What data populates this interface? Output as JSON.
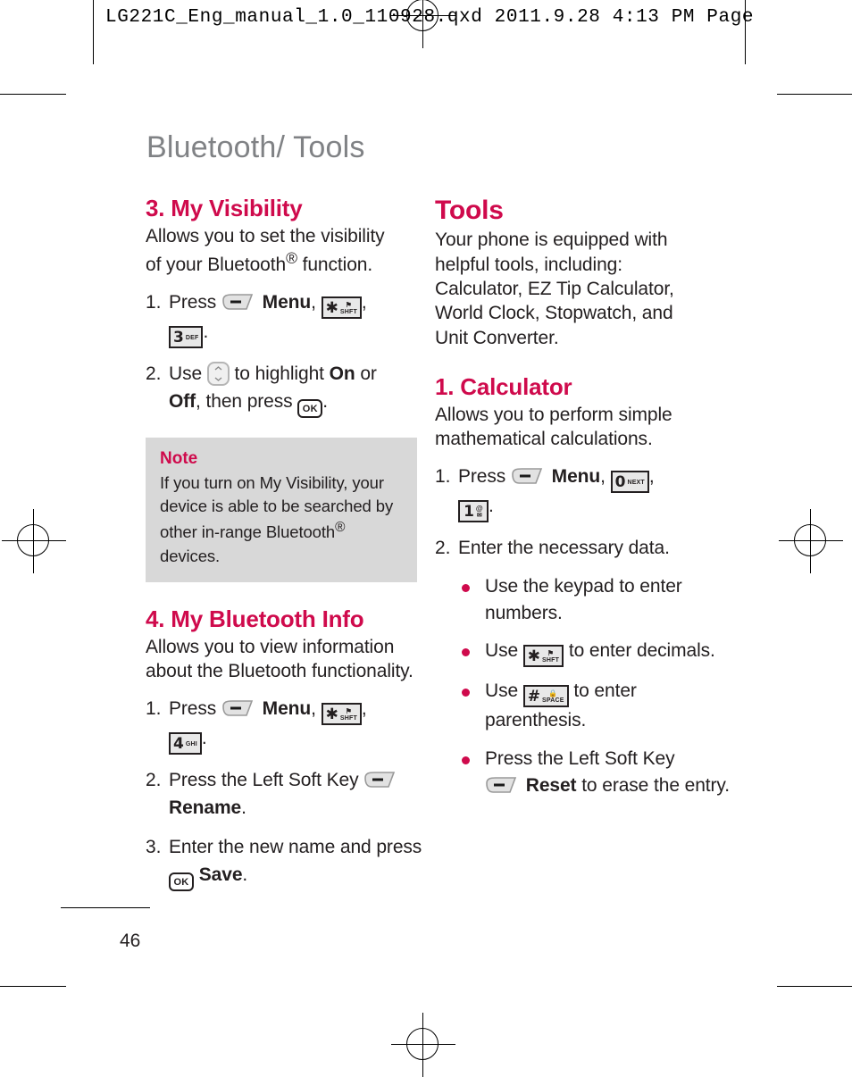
{
  "preflight": {
    "text": "LG221C_Eng_manual_1.0_110928.qxd   2011.9.28   4:13 PM   Page"
  },
  "page": {
    "chapter_title": "Bluetooth/ Tools",
    "page_number": "46",
    "accent_color": "#cf0a4c",
    "title_color": "#808285",
    "note_bg_color": "#d8d8d8"
  },
  "left_column": {
    "section_visibility": {
      "heading": "3. My Visibility",
      "intro_line1": "Allows you to set the visibility",
      "intro_line2_a": "of your Bluetooth",
      "intro_line2_sup": "®",
      "intro_line2_b": " function.",
      "steps": [
        {
          "num": "1.",
          "before": "Press ",
          "key1": "left-soft-key",
          "mid": " ",
          "bold1": "Menu",
          "after1": ", ",
          "key2": "star-shift-key",
          "after2": ", ",
          "key3": "3-def-key",
          "after3": "."
        },
        {
          "num": "2.",
          "before": "Use ",
          "key1": "navigation-pad",
          "mid": " to highlight ",
          "bold1": "On",
          "after1": " or ",
          "bold2": "Off",
          "after2": ", then press ",
          "key2": "ok-key",
          "after3": "."
        }
      ]
    },
    "note": {
      "title": "Note",
      "line1": "If you turn on My Visibility, your",
      "line2": "device is able to be searched by",
      "line3_a": "other in-range Bluetooth",
      "line3_sup": "®",
      "line3_b": " devices."
    },
    "section_bt_info": {
      "heading": "4. My Bluetooth Info",
      "intro_line1": "Allows you to view information",
      "intro_line2": "about the Bluetooth functionality.",
      "steps": [
        {
          "num": "1.",
          "before": "Press ",
          "key1": "left-soft-key",
          "mid": " ",
          "bold1": "Menu",
          "after1": ", ",
          "key2": "star-shift-key",
          "after2": ", ",
          "key3": "4-ghi-key",
          "after3": "."
        },
        {
          "num": "2.",
          "before": "Press the Left Soft Key ",
          "key1": "left-soft-key",
          "mid": " ",
          "bold1": "Rename",
          "after1": "."
        },
        {
          "num": "3.",
          "before": "Enter the new name and press ",
          "key1": "ok-key",
          "mid": " ",
          "bold1": "Save",
          "after1": "."
        }
      ]
    }
  },
  "right_column": {
    "section_tools": {
      "heading": "Tools",
      "body_line1": "Your phone is equipped with",
      "body_line2": "helpful tools, including:",
      "body_line3": "Calculator, EZ Tip Calculator,",
      "body_line4": "World Clock, Stopwatch, and",
      "body_line5": "Unit Converter."
    },
    "section_calculator": {
      "heading": "1. Calculator",
      "intro_line1": "Allows you to perform simple",
      "intro_line2": "mathematical calculations.",
      "steps": [
        {
          "num": "1.",
          "before": "Press ",
          "key1": "left-soft-key",
          "mid": " ",
          "bold1": "Menu",
          "after1": ", ",
          "key2": "0-next-key",
          "after2": ", ",
          "key3": "1-at-key",
          "after3": "."
        },
        {
          "num": "2.",
          "before": "Enter the necessary data.",
          "bold1": "",
          "after1": ""
        }
      ],
      "bullets": [
        {
          "before": "Use the keypad to enter numbers.",
          "key1": "",
          "after1": ""
        },
        {
          "before": "Use ",
          "key1": "star-shift-key",
          "after1": " to enter decimals."
        },
        {
          "before": "Use ",
          "key1": "hash-space-key",
          "after1": " to enter parenthesis."
        },
        {
          "before": "Press the Left Soft Key ",
          "key1": "left-soft-key",
          "mid": " ",
          "bold1": "Reset",
          "after1": " to erase the entry."
        }
      ]
    }
  },
  "key_icons": {
    "left_soft_key": {
      "name": "left-soft-key",
      "glyph": "–"
    },
    "star_shift_key": {
      "name": "star-shift-key",
      "glyph": "✱",
      "sub_top": "⚑",
      "sub_bottom": "SHFT"
    },
    "hash_space_key": {
      "name": "hash-space-key",
      "glyph": "#",
      "sub_top": "⚿",
      "sub_bottom": "SPACE"
    },
    "three_def_key": {
      "name": "3-def-key",
      "glyph": "3",
      "sub": "DEF"
    },
    "four_ghi_key": {
      "name": "4-ghi-key",
      "glyph": "4",
      "sub": "GHI"
    },
    "zero_next_key": {
      "name": "0-next-key",
      "glyph": "0",
      "sub": "NEXT"
    },
    "one_at_key": {
      "name": "1-at-key",
      "glyph": "1",
      "sub": "@"
    },
    "ok_key": {
      "name": "ok-key",
      "label": "OK"
    },
    "navigation_pad": {
      "name": "navigation-pad",
      "up": "˄",
      "down": "˅"
    }
  }
}
